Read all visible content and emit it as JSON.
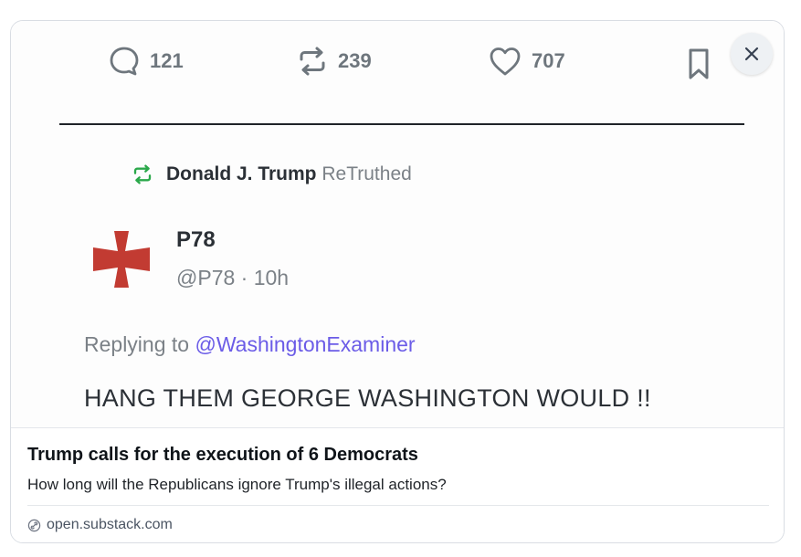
{
  "post": {
    "actions": {
      "reply_count": "121",
      "retruth_count": "239",
      "like_count": "707"
    },
    "retruth": {
      "who": "Donald J. Trump",
      "label": "ReTruthed"
    },
    "author": {
      "name": "P78",
      "meta": "@P78 · 10h"
    },
    "replying_prefix": "Replying to",
    "replying_handle": "@WashingtonExaminer",
    "text": "HANG THEM GEORGE WASHINGTON WOULD !!"
  },
  "link": {
    "title": "Trump calls for the execution of 6 Democrats",
    "subtitle": "How long will the Republicans ignore Trump's illegal actions?",
    "source": "open.substack.com"
  },
  "colors": {
    "retruth_icon": "#2aa84a",
    "avatar_cross": "#c23b32",
    "mention": "#6b5ce7"
  }
}
